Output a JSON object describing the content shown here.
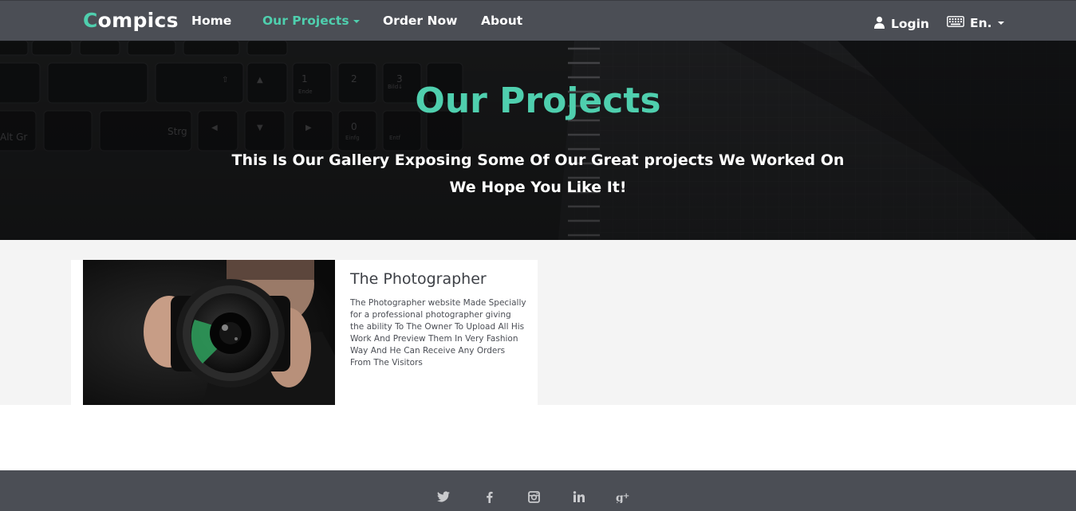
{
  "nav": {
    "brand_first": "C",
    "brand_rest": "ompics",
    "links": [
      "Home",
      "Our Projects",
      "Order Now",
      "About"
    ],
    "login_label": "Login",
    "language_label": "En."
  },
  "hero": {
    "title": "Our Projects",
    "subtitle_line1": "This Is Our Gallery Exposing Some Of Our Great projects We Worked On",
    "subtitle_line2": "We Hope You Like It!"
  },
  "projects": [
    {
      "title": "The Photographer",
      "description": "The Photographer website Made Specially for a professional photographer giving the ability To The Owner To Upload All His Work And Preview Them In Very Fashion Way And He Can Receive Any Orders From The Visitors"
    }
  ],
  "footer": {
    "social_icons": [
      "twitter-icon",
      "facebook-icon",
      "instagram-icon",
      "linkedin-icon",
      "google-plus-icon"
    ]
  },
  "colors": {
    "accent": "#4fcfae",
    "nav_bg": "#4b4e55",
    "content_bg": "#f4f4f4"
  }
}
